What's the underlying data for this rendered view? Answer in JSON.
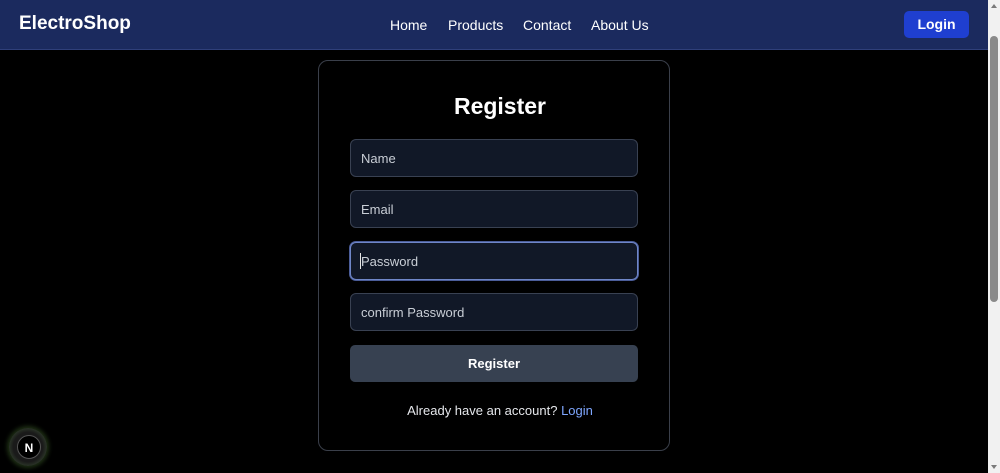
{
  "header": {
    "brand": "ElectroShop",
    "nav": [
      "Home",
      "Products",
      "Contact",
      "About Us"
    ],
    "login_label": "Login",
    "colors": {
      "background": "#1b2a5e",
      "login_button": "#1f3fd0"
    }
  },
  "form": {
    "title": "Register",
    "fields": {
      "name_placeholder": "Name",
      "email_placeholder": "Email",
      "password_placeholder": "Password",
      "confirm_placeholder": "confirm Password"
    },
    "submit_label": "Register",
    "footer_prompt": "Already have an account?",
    "footer_link": "Login"
  },
  "badge": {
    "letter": "N"
  }
}
